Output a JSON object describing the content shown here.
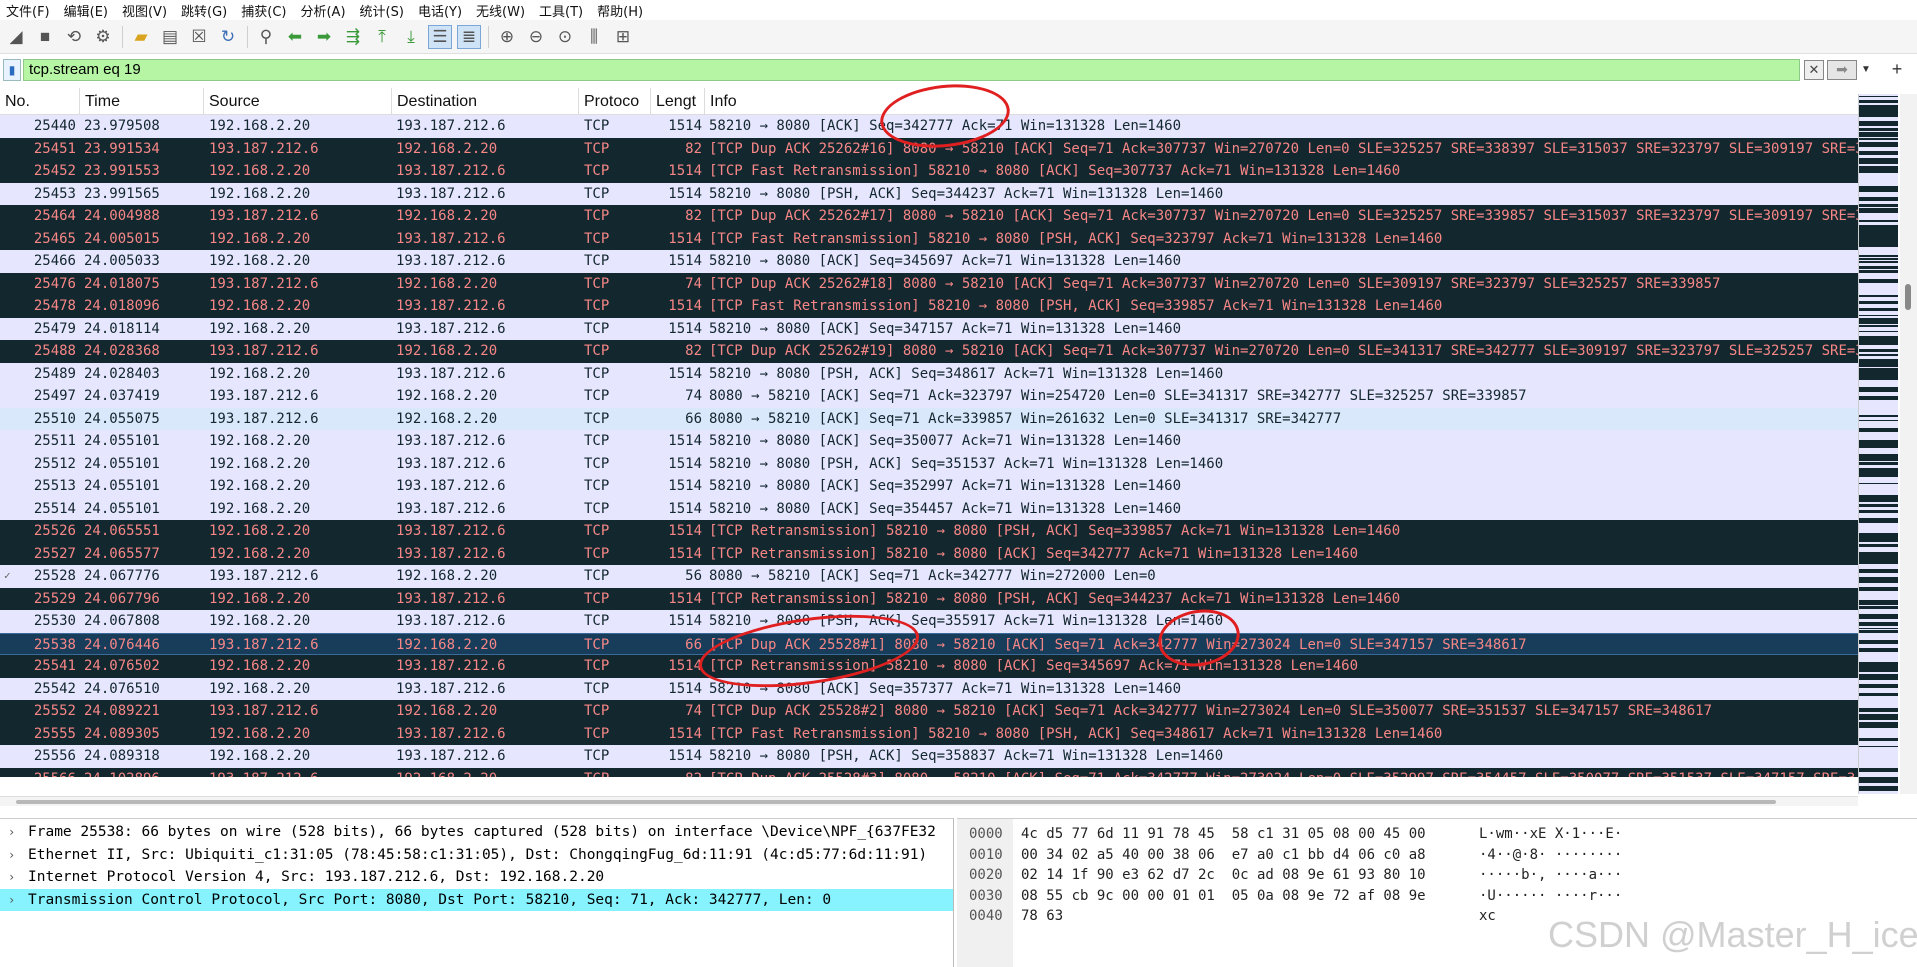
{
  "menu": [
    "文件(F)",
    "编辑(E)",
    "视图(V)",
    "跳转(G)",
    "捕获(C)",
    "分析(A)",
    "统计(S)",
    "电话(Y)",
    "无线(W)",
    "工具(T)",
    "帮助(H)"
  ],
  "filter": {
    "value": "tcp.stream eq 19"
  },
  "columns": {
    "no": "No.",
    "time": "Time",
    "source": "Source",
    "destination": "Destination",
    "protocol": "Protoco",
    "length": "Lengt",
    "info": "Info"
  },
  "packets": [
    {
      "no": "25440",
      "time": "23.979508",
      "src": "192.168.2.20",
      "dst": "193.187.212.6",
      "proto": "TCP",
      "len": "1514",
      "info": "58210 → 8080 [ACK] Seq=342777 Ack=71 Win=131328 Len=1460",
      "style": "light"
    },
    {
      "no": "25451",
      "time": "23.991534",
      "src": "193.187.212.6",
      "dst": "192.168.2.20",
      "proto": "TCP",
      "len": "82",
      "info": "[TCP Dup ACK 25262#16] 8080 → 58210 [ACK] Seq=71 Ack=307737 Win=270720 Len=0 SLE=325257 SRE=338397 SLE=315037 SRE=323797 SLE=309197 SRE=31",
      "style": "dark"
    },
    {
      "no": "25452",
      "time": "23.991553",
      "src": "192.168.2.20",
      "dst": "193.187.212.6",
      "proto": "TCP",
      "len": "1514",
      "info": "[TCP Fast Retransmission] 58210 → 8080 [ACK] Seq=307737 Ack=71 Win=131328 Len=1460",
      "style": "dark"
    },
    {
      "no": "25453",
      "time": "23.991565",
      "src": "192.168.2.20",
      "dst": "193.187.212.6",
      "proto": "TCP",
      "len": "1514",
      "info": "58210 → 8080 [PSH, ACK] Seq=344237 Ack=71 Win=131328 Len=1460",
      "style": "light"
    },
    {
      "no": "25464",
      "time": "24.004988",
      "src": "193.187.212.6",
      "dst": "192.168.2.20",
      "proto": "TCP",
      "len": "82",
      "info": "[TCP Dup ACK 25262#17] 8080 → 58210 [ACK] Seq=71 Ack=307737 Win=270720 Len=0 SLE=325257 SRE=339857 SLE=315037 SRE=323797 SLE=309197 SRE=31",
      "style": "dark"
    },
    {
      "no": "25465",
      "time": "24.005015",
      "src": "192.168.2.20",
      "dst": "193.187.212.6",
      "proto": "TCP",
      "len": "1514",
      "info": "[TCP Fast Retransmission] 58210 → 8080 [PSH, ACK] Seq=323797 Ack=71 Win=131328 Len=1460",
      "style": "dark"
    },
    {
      "no": "25466",
      "time": "24.005033",
      "src": "192.168.2.20",
      "dst": "193.187.212.6",
      "proto": "TCP",
      "len": "1514",
      "info": "58210 → 8080 [ACK] Seq=345697 Ack=71 Win=131328 Len=1460",
      "style": "light"
    },
    {
      "no": "25476",
      "time": "24.018075",
      "src": "193.187.212.6",
      "dst": "192.168.2.20",
      "proto": "TCP",
      "len": "74",
      "info": "[TCP Dup ACK 25262#18] 8080 → 58210 [ACK] Seq=71 Ack=307737 Win=270720 Len=0 SLE=309197 SRE=323797 SLE=325257 SRE=339857",
      "style": "dark"
    },
    {
      "no": "25478",
      "time": "24.018096",
      "src": "192.168.2.20",
      "dst": "193.187.212.6",
      "proto": "TCP",
      "len": "1514",
      "info": "[TCP Fast Retransmission] 58210 → 8080 [PSH, ACK] Seq=339857 Ack=71 Win=131328 Len=1460",
      "style": "dark"
    },
    {
      "no": "25479",
      "time": "24.018114",
      "src": "192.168.2.20",
      "dst": "193.187.212.6",
      "proto": "TCP",
      "len": "1514",
      "info": "58210 → 8080 [ACK] Seq=347157 Ack=71 Win=131328 Len=1460",
      "style": "light"
    },
    {
      "no": "25488",
      "time": "24.028368",
      "src": "193.187.212.6",
      "dst": "192.168.2.20",
      "proto": "TCP",
      "len": "82",
      "info": "[TCP Dup ACK 25262#19] 8080 → 58210 [ACK] Seq=71 Ack=307737 Win=270720 Len=0 SLE=341317 SRE=342777 SLE=309197 SRE=323797 SLE=325257 SRE=33",
      "style": "dark"
    },
    {
      "no": "25489",
      "time": "24.028403",
      "src": "192.168.2.20",
      "dst": "193.187.212.6",
      "proto": "TCP",
      "len": "1514",
      "info": "58210 → 8080 [PSH, ACK] Seq=348617 Ack=71 Win=131328 Len=1460",
      "style": "light"
    },
    {
      "no": "25497",
      "time": "24.037419",
      "src": "193.187.212.6",
      "dst": "192.168.2.20",
      "proto": "TCP",
      "len": "74",
      "info": "8080 → 58210 [ACK] Seq=71 Ack=323797 Win=254720 Len=0 SLE=341317 SRE=342777 SLE=325257 SRE=339857",
      "style": "light"
    },
    {
      "no": "25510",
      "time": "24.055075",
      "src": "193.187.212.6",
      "dst": "192.168.2.20",
      "proto": "TCP",
      "len": "66",
      "info": "8080 → 58210 [ACK] Seq=71 Ack=339857 Win=261632 Len=0 SLE=341317 SRE=342777",
      "style": "pale"
    },
    {
      "no": "25511",
      "time": "24.055101",
      "src": "192.168.2.20",
      "dst": "193.187.212.6",
      "proto": "TCP",
      "len": "1514",
      "info": "58210 → 8080 [ACK] Seq=350077 Ack=71 Win=131328 Len=1460",
      "style": "light"
    },
    {
      "no": "25512",
      "time": "24.055101",
      "src": "192.168.2.20",
      "dst": "193.187.212.6",
      "proto": "TCP",
      "len": "1514",
      "info": "58210 → 8080 [PSH, ACK] Seq=351537 Ack=71 Win=131328 Len=1460",
      "style": "light"
    },
    {
      "no": "25513",
      "time": "24.055101",
      "src": "192.168.2.20",
      "dst": "193.187.212.6",
      "proto": "TCP",
      "len": "1514",
      "info": "58210 → 8080 [ACK] Seq=352997 Ack=71 Win=131328 Len=1460",
      "style": "light"
    },
    {
      "no": "25514",
      "time": "24.055101",
      "src": "192.168.2.20",
      "dst": "193.187.212.6",
      "proto": "TCP",
      "len": "1514",
      "info": "58210 → 8080 [ACK] Seq=354457 Ack=71 Win=131328 Len=1460",
      "style": "light"
    },
    {
      "no": "25526",
      "time": "24.065551",
      "src": "192.168.2.20",
      "dst": "193.187.212.6",
      "proto": "TCP",
      "len": "1514",
      "info": "[TCP Retransmission] 58210 → 8080 [PSH, ACK] Seq=339857 Ack=71 Win=131328 Len=1460",
      "style": "dark"
    },
    {
      "no": "25527",
      "time": "24.065577",
      "src": "192.168.2.20",
      "dst": "193.187.212.6",
      "proto": "TCP",
      "len": "1514",
      "info": "[TCP Retransmission] 58210 → 8080 [ACK] Seq=342777 Ack=71 Win=131328 Len=1460",
      "style": "dark"
    },
    {
      "no": "25528",
      "time": "24.067776",
      "src": "193.187.212.6",
      "dst": "192.168.2.20",
      "proto": "TCP",
      "len": "56",
      "info": "8080 → 58210 [ACK] Seq=71 Ack=342777 Win=272000 Len=0",
      "style": "light",
      "mark": "✓"
    },
    {
      "no": "25529",
      "time": "24.067796",
      "src": "192.168.2.20",
      "dst": "193.187.212.6",
      "proto": "TCP",
      "len": "1514",
      "info": "[TCP Retransmission] 58210 → 8080 [PSH, ACK] Seq=344237 Ack=71 Win=131328 Len=1460",
      "style": "dark"
    },
    {
      "no": "25530",
      "time": "24.067808",
      "src": "192.168.2.20",
      "dst": "193.187.212.6",
      "proto": "TCP",
      "len": "1514",
      "info": "58210 → 8080 [PSH, ACK] Seq=355917 Ack=71 Win=131328 Len=1460",
      "style": "light"
    },
    {
      "no": "25538",
      "time": "24.076446",
      "src": "193.187.212.6",
      "dst": "192.168.2.20",
      "proto": "TCP",
      "len": "66",
      "info": "[TCP Dup ACK 25528#1] 8080 → 58210 [ACK] Seq=71 Ack=342777 Win=273024 Len=0 SLE=347157 SRE=348617",
      "style": "selected"
    },
    {
      "no": "25541",
      "time": "24.076502",
      "src": "192.168.2.20",
      "dst": "193.187.212.6",
      "proto": "TCP",
      "len": "1514",
      "info": "[TCP Retransmission] 58210 → 8080 [ACK] Seq=345697 Ack=71 Win=131328 Len=1460",
      "style": "dark"
    },
    {
      "no": "25542",
      "time": "24.076510",
      "src": "192.168.2.20",
      "dst": "193.187.212.6",
      "proto": "TCP",
      "len": "1514",
      "info": "58210 → 8080 [ACK] Seq=357377 Ack=71 Win=131328 Len=1460",
      "style": "light"
    },
    {
      "no": "25552",
      "time": "24.089221",
      "src": "193.187.212.6",
      "dst": "192.168.2.20",
      "proto": "TCP",
      "len": "74",
      "info": "[TCP Dup ACK 25528#2] 8080 → 58210 [ACK] Seq=71 Ack=342777 Win=273024 Len=0 SLE=350077 SRE=351537 SLE=347157 SRE=348617",
      "style": "dark"
    },
    {
      "no": "25555",
      "time": "24.089305",
      "src": "192.168.2.20",
      "dst": "193.187.212.6",
      "proto": "TCP",
      "len": "1514",
      "info": "[TCP Fast Retransmission] 58210 → 8080 [PSH, ACK] Seq=348617 Ack=71 Win=131328 Len=1460",
      "style": "dark"
    },
    {
      "no": "25556",
      "time": "24.089318",
      "src": "192.168.2.20",
      "dst": "193.187.212.6",
      "proto": "TCP",
      "len": "1514",
      "info": "58210 → 8080 [PSH, ACK] Seq=358837 Ack=71 Win=131328 Len=1460",
      "style": "light"
    },
    {
      "no": "25566",
      "time": "24.102896",
      "src": "193.187.212.6",
      "dst": "192.168.2.20",
      "proto": "TCP",
      "len": "82",
      "info": "[TCP Dup ACK 25528#3] 8080 → 58210 [ACK] Seq=71 Ack=342777 Win=273024 Len=0 SLE=352997 SRE=354457 SLE=350077 SRE=351537 SLE=347157 SRE=3",
      "style": "dark"
    }
  ],
  "details": [
    {
      "text": "Frame 25538: 66 bytes on wire (528 bits), 66 bytes captured (528 bits) on interface \\Device\\NPF_{637FE32",
      "selected": false
    },
    {
      "text": "Ethernet II, Src: Ubiquiti_c1:31:05 (78:45:58:c1:31:05), Dst: ChongqingFug_6d:11:91 (4c:d5:77:6d:11:91)",
      "selected": false
    },
    {
      "text": "Internet Protocol Version 4, Src: 193.187.212.6, Dst: 192.168.2.20",
      "selected": false
    },
    {
      "text": "Transmission Control Protocol, Src Port: 8080, Dst Port: 58210, Seq: 71, Ack: 342777, Len: 0",
      "selected": true
    }
  ],
  "bytes": [
    {
      "offset": "0000",
      "hex": "4c d5 77 6d 11 91 78 45  58 c1 31 05 08 00 45 00",
      "ascii": "L·wm··xE X·1···E·"
    },
    {
      "offset": "0010",
      "hex": "00 34 02 a5 40 00 38 06  e7 a0 c1 bb d4 06 c0 a8",
      "ascii": "·4··@·8· ········"
    },
    {
      "offset": "0020",
      "hex": "02 14 1f 90 e3 62 d7 2c  0c ad 08 9e 61 93 80 10",
      "ascii": "·····b·, ····a···"
    },
    {
      "offset": "0030",
      "hex": "08 55 cb 9c 00 00 01 01  05 0a 08 9e 72 af 08 9e",
      "ascii": "·U······ ····r···"
    },
    {
      "offset": "0040",
      "hex": "78 63",
      "ascii": "xc"
    }
  ],
  "watermark": "CSDN @Master_H_ice",
  "colors": {
    "filter_bg": "#b5f5a3",
    "row_light": "#e7e6ff",
    "row_dark": "#12272e",
    "row_dark_text": "#f78787",
    "row_selected": "#183d5a",
    "detail_selected": "#86f3ff",
    "annotation": "#e02020"
  }
}
